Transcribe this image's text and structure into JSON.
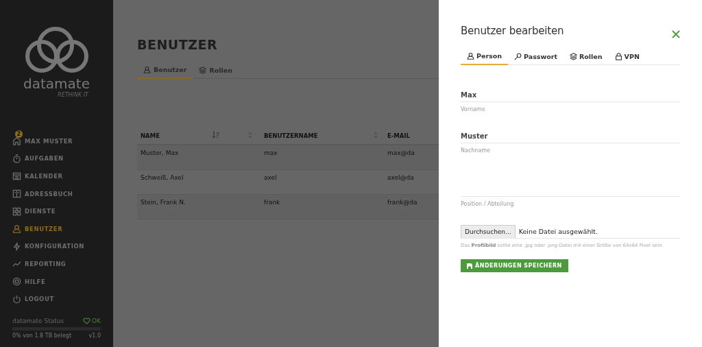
{
  "sidebar": {
    "logo": {
      "name": "datamate",
      "tagline": "RETHINK IT"
    },
    "items": [
      {
        "label": "MAX MUSTER",
        "badge": "2",
        "selected": false
      },
      {
        "label": "AUFGABEN",
        "selected": false
      },
      {
        "label": "KALENDER",
        "selected": false
      },
      {
        "label": "ADRESSBUCH",
        "selected": false
      },
      {
        "label": "DIENSTE",
        "selected": false
      },
      {
        "label": "BENUTZER",
        "selected": true
      },
      {
        "label": "KONFIGURATION",
        "selected": false
      },
      {
        "label": "REPORTING",
        "selected": false
      },
      {
        "label": "HILFE",
        "selected": false
      },
      {
        "label": "LOGOUT",
        "selected": false
      }
    ],
    "status": {
      "title": "datamate Status",
      "state": "OK",
      "level": 0,
      "usage": "0% von 1.8 TB belegt",
      "version": "v1.0"
    }
  },
  "page": {
    "title": "BENUTZER",
    "tabs": [
      {
        "label": "Benutzer",
        "selected": true
      },
      {
        "label": "Rollen",
        "selected": false
      }
    ],
    "table": {
      "columns": [
        "NAME",
        "BENUTZERNAME",
        "E-MAIL"
      ],
      "rows": [
        [
          "Muster, Max",
          "max",
          "max@da"
        ],
        [
          "Schweiß, Axel",
          "axel",
          "axel@da"
        ],
        [
          "Stein, Frank N.",
          "frank",
          "frank@da"
        ]
      ]
    }
  },
  "dialog": {
    "title": "Benutzer bearbeiten",
    "tabs": [
      {
        "label": "Person",
        "selected": true
      },
      {
        "label": "Passwort",
        "selected": false
      },
      {
        "label": "Rollen",
        "selected": false
      },
      {
        "label": "VPN",
        "selected": false
      }
    ],
    "fields": [
      {
        "value": "Max",
        "label": "Vorname"
      },
      {
        "value": "Muster",
        "label": "Nachname"
      },
      {
        "label": "Position / Abteilung"
      }
    ],
    "file": {
      "button": "Durchsuchen...",
      "status": "Keine Datei ausgewählt.",
      "hint": "Das **Profilbild** sollte eine .jpg oder .png-Datei mit einer Größe von 64x64 Pixel sein."
    },
    "save": "ÄNDERUNGEN SPEICHERN"
  }
}
